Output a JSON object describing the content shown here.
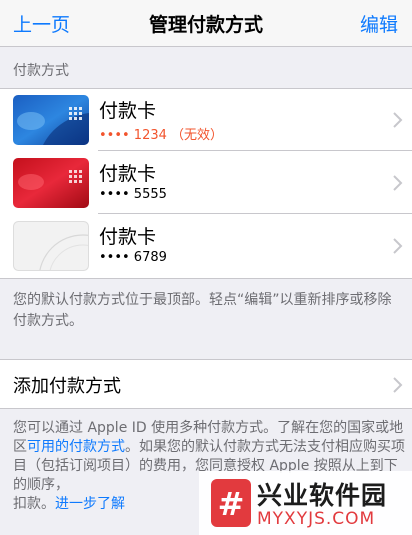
{
  "navbar": {
    "back_label": "上一页",
    "title": "管理付款方式",
    "edit_label": "编辑"
  },
  "payment_section": {
    "header": "付款方式",
    "cards": [
      {
        "name": "付款卡",
        "number": "•••• 1234 （无效）",
        "style": "blue",
        "expired": true
      },
      {
        "name": "付款卡",
        "number": "•••• 5555",
        "style": "red",
        "expired": false
      },
      {
        "name": "付款卡",
        "number": "•••• 6789",
        "style": "white",
        "expired": false
      }
    ],
    "footer": "您的默认付款方式位于最顶部。轻点“编辑”以重新排序或移除付款方式。"
  },
  "add_payment": {
    "label": "添加付款方式"
  },
  "info": {
    "text_1": "您可以通过 Apple ID 使用多种付款方式。了解在您的国家或地区",
    "link_1": "可用的付款方式",
    "text_2": "。如果您的默认付款方式无法支付相应购买项目（包括订阅项目）的费用，您同意授权 Apple 按照从上到下的顺序，",
    "text_3": "扣款。",
    "link_2": "进一步了解"
  },
  "watermark": {
    "logo_glyph": "#",
    "title": "兴业软件园",
    "subtitle": "MYXYJS.COM"
  },
  "colors": {
    "accent": "#0e7afe",
    "expired": "#f2542d",
    "background": "#efeff4"
  }
}
